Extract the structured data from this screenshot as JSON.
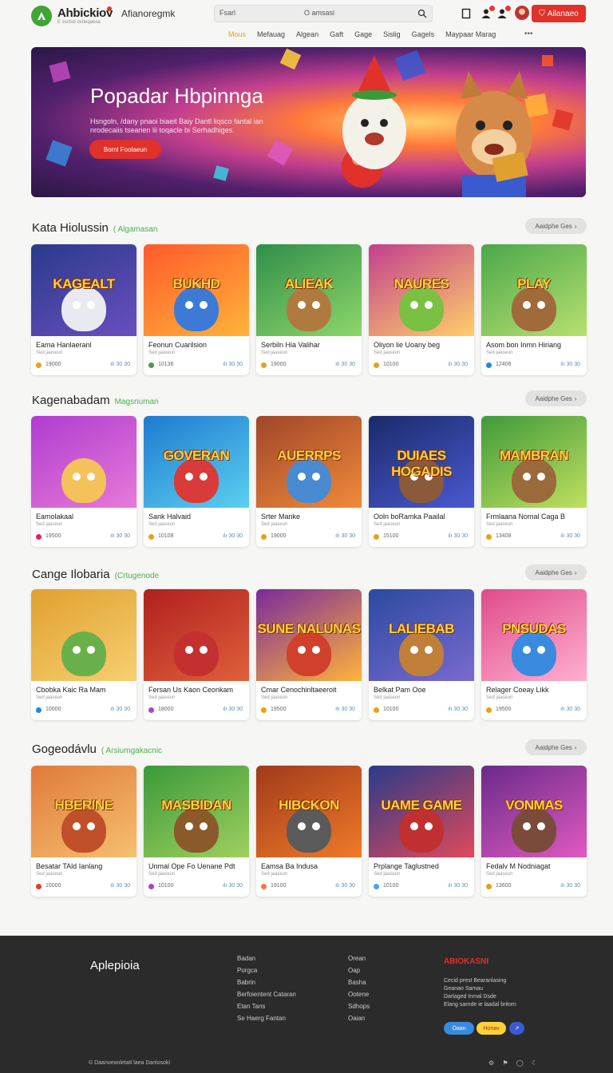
{
  "header": {
    "logo_text": "Ahbickiov",
    "logo_sub": "E ssctsd ovrleqaesa",
    "site_sub": "Afianoregmk",
    "search_value": "Fsarl",
    "search_placeholder": "O amsasi",
    "cta_label": "Ailanaeo"
  },
  "nav": {
    "items": [
      "Mous",
      "Mefauag",
      "Algean",
      "Gaft",
      "Gage",
      "Sislig",
      "Gagels",
      "Maypaar Marag"
    ],
    "active": 0,
    "more": "•••"
  },
  "hero": {
    "title": "Popadar Hbpinnga",
    "desc": "Hsngoln, /dany pnaoi biaeit Baiy Dantl liqsco fantal ian nrodecaiis tsearien lii toqacle bi Serhadhiges.",
    "button": "Bornl Foolaeun"
  },
  "sections": [
    {
      "title": "Kata Hiolussin",
      "sub": "( Algamasan",
      "more": "Aaidphe Ges",
      "cards": [
        {
          "name": "Eama Hanlaeranl",
          "dev": "Sed jaaseun",
          "val": "19000",
          "stats": "30  30",
          "dot": "#e2a21a",
          "art": "KAGEALT",
          "c1": "#2a3a8a",
          "c2": "#6a4fc0",
          "m": "#e9e9f2"
        },
        {
          "name": "Feonun Cuarilsion",
          "dev": "Sed jaaseun",
          "val": "10136",
          "stats": "30  30",
          "dot": "#43a047",
          "art": "BUKHD",
          "c1": "#ff5a2a",
          "c2": "#ffb43a",
          "m": "#3d7ad6"
        },
        {
          "name": "Serbiln Hia Valihar",
          "dev": "Sed jaaseun",
          "val": "19000",
          "stats": "30  30",
          "dot": "#e2a21a",
          "art": "ALIEAK",
          "c1": "#2f8f4a",
          "c2": "#8fd66a",
          "m": "#b07a3f"
        },
        {
          "name": "Oliyon lie Uoany beg",
          "dev": "Sed jaaseun",
          "val": "10100",
          "stats": "30  30",
          "dot": "#e2a21a",
          "art": "NAURES",
          "c1": "#c33f8e",
          "c2": "#ffcf6a",
          "m": "#7ac043"
        },
        {
          "name": "Asom bon Inmn Hiriang",
          "dev": "Sed jaaseun",
          "val": "12406",
          "stats": "30  30",
          "dot": "#1e88e5",
          "art": "PLAY",
          "c1": "#4aa84a",
          "c2": "#b8e070",
          "m": "#a06a3a"
        }
      ]
    },
    {
      "title": "Kagenabadam",
      "sub": "Magsnuman",
      "more": "Aaidphe Ges",
      "cards": [
        {
          "name": "Eamolakaal",
          "dev": "Sed jaaseun",
          "val": "19500",
          "stats": "30  30",
          "dot": "#e91e63",
          "art": "",
          "c1": "#b03cd0",
          "c2": "#e87ad8",
          "m": "#f4c15a"
        },
        {
          "name": "Sank Halvaid",
          "dev": "Sed jaaseun",
          "val": "10108",
          "stats": "30  30",
          "dot": "#e2a21a",
          "art": "GOVERAN",
          "c1": "#1f7ad0",
          "c2": "#5ad0f0",
          "m": "#d93a3a"
        },
        {
          "name": "Srter Manke",
          "dev": "Sed jaaseun",
          "val": "19000",
          "stats": "30  30",
          "dot": "#e2a21a",
          "art": "AUERRPS",
          "c1": "#a0462a",
          "c2": "#f08a3a",
          "m": "#4a8ad0"
        },
        {
          "name": "Ooln boRamka Paailal",
          "dev": "Sed jaaseun",
          "val": "15100",
          "stats": "30  30",
          "dot": "#e2a21a",
          "art": "DUIAES HOGADIS",
          "c1": "#1a2a6a",
          "c2": "#4a5ad0",
          "m": "#8a5a3a"
        },
        {
          "name": "Frmlaana Nomal Caga B",
          "dev": "Sed jaaseun",
          "val": "13408",
          "stats": "30  30",
          "dot": "#e2a21a",
          "art": "MAMBRAN",
          "c1": "#3f9a3a",
          "c2": "#c0e060",
          "m": "#9a6a3a"
        }
      ]
    },
    {
      "title": "Cange Ilobaria",
      "sub": "(Crtugenode",
      "more": "Aaidphe Ges",
      "cards": [
        {
          "name": "Cbobka Kaic Ra Mam",
          "dev": "Sed jaaseun",
          "val": "10000",
          "stats": "30  30",
          "dot": "#1e88e5",
          "art": "",
          "c1": "#e0a030",
          "c2": "#f6d070",
          "m": "#6ab04a"
        },
        {
          "name": "Fersan Us Kaon Ceonkam",
          "dev": "Sed jaaseun",
          "val": "18000",
          "stats": "30  30",
          "dot": "#ab47bc",
          "art": "",
          "c1": "#b02020",
          "c2": "#e0603a",
          "m": "#c43030"
        },
        {
          "name": "Cmar Cenochinltaeeroit",
          "dev": "Sed jaaseun",
          "val": "19500",
          "stats": "30  30",
          "dot": "#e2a21a",
          "art": "SUNE NALUNAS",
          "c1": "#7a2a9a",
          "c2": "#ffb43a",
          "m": "#d0402a"
        },
        {
          "name": "Belkat Pam Ooe",
          "dev": "Sed jaaseun",
          "val": "10100",
          "stats": "30  30",
          "dot": "#e2a21a",
          "art": "LALIEBAB",
          "c1": "#2a4aa0",
          "c2": "#7a6ad0",
          "m": "#c0803a"
        },
        {
          "name": "Relager Coeay Likk",
          "dev": "Sed jaaseun",
          "val": "19500",
          "stats": "30  30",
          "dot": "#e2a21a",
          "art": "PNSUDAS",
          "c1": "#e04a8a",
          "c2": "#ffb0d0",
          "m": "#3a8ae0"
        }
      ]
    },
    {
      "title": "Gogeodávlu",
      "sub": "( Arsiumgakacnic",
      "more": "Aaidphe Ges",
      "cards": [
        {
          "name": "Besatar TAld Ianlang",
          "dev": "Sed jaaseun",
          "val": "10000",
          "stats": "30  30",
          "dot": "#e53935",
          "art": "HBERINE",
          "c1": "#e07a3a",
          "c2": "#f6c070",
          "m": "#c0502a"
        },
        {
          "name": "Unmal Ope Fo Uenane Pdt",
          "dev": "Sed jaaseun",
          "val": "10100",
          "stats": "30  30",
          "dot": "#ab47bc",
          "art": "MASBIDAN",
          "c1": "#3a9a3a",
          "c2": "#a0d060",
          "m": "#8a5a2a"
        },
        {
          "name": "Eamsa Ba Indusa",
          "dev": "Sed jaaseun",
          "val": "19100",
          "stats": "30  30",
          "dot": "#ff7043",
          "art": "HIBCKON",
          "c1": "#a03a1a",
          "c2": "#f07a2a",
          "m": "#5a5a5a"
        },
        {
          "name": "Prplange Taglustned",
          "dev": "Sed jaaseun",
          "val": "10100",
          "stats": "30  30",
          "dot": "#42a5f5",
          "art": "UAME GAME",
          "c1": "#2a3a8a",
          "c2": "#e04a5a",
          "m": "#c03030"
        },
        {
          "name": "Fedalv M Nodniagat",
          "dev": "Sed jaaseun",
          "val": "13600",
          "stats": "30  30",
          "dot": "#e2a21a",
          "art": "VONMAS",
          "c1": "#6a2a8a",
          "c2": "#e05ac0",
          "m": "#7a4a3a"
        }
      ]
    }
  ],
  "footer": {
    "brand": "Aplepioia",
    "col1": [
      "Badan",
      "Porgca",
      "Babrin",
      "Berfoientent Cataran",
      "Etan Tans",
      "Se Haerg Fantan"
    ],
    "col2": [
      "Orean",
      "Oap",
      "Basha",
      "Ootene",
      "Sdhops",
      "Oaian"
    ],
    "head": "ABIOKASNI",
    "lines": [
      "Cecid prest Bearanlasing",
      "Geanao Samau",
      "Darlaged Inmal Dsde",
      "Elang sarnde ie laadal britom"
    ],
    "btn1": "Oaan",
    "btn2": "Honav",
    "btn3": "↗",
    "copyright": "© Daanoeanletatl laea Danlosoki",
    "icons": "⚙ ⚑ ◯ ☾"
  }
}
